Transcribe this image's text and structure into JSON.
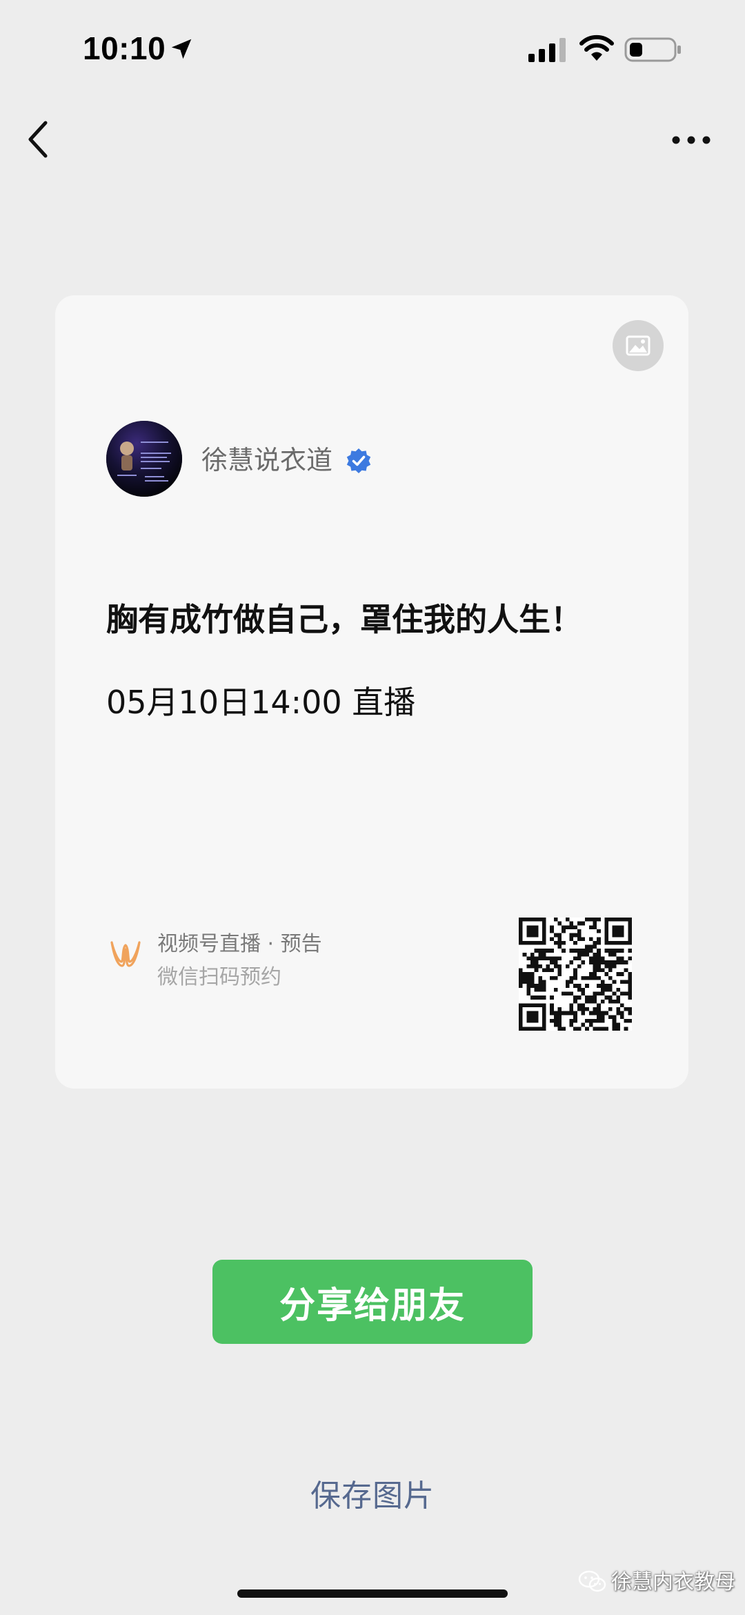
{
  "status_bar": {
    "time": "10:10",
    "location_icon": "location-arrow-icon",
    "signal_icon": "cellular-signal-icon",
    "wifi_icon": "wifi-icon",
    "battery_icon": "battery-icon",
    "battery_level": 0.3
  },
  "nav": {
    "back_icon": "chevron-left-icon",
    "more_icon": "ellipsis-icon"
  },
  "poster": {
    "image_toggle_icon": "image-icon",
    "author": {
      "name": "徐慧说衣道",
      "verified": true,
      "verified_icon": "verified-badge-icon",
      "verified_color": "#3d7ae0"
    },
    "live_title": "胸有成竹做自己，罩住我的人生！",
    "live_time": "05月10日14:00 直播",
    "footer": {
      "channels_label": "视频号直播 · 预告",
      "scan_label": "微信扫码预约",
      "channels_icon": "channels-logo-icon",
      "channels_color": "#f0a35c",
      "qr_icon": "qr-code-icon"
    }
  },
  "actions": {
    "share_label": "分享给朋友",
    "share_color": "#4cc162",
    "save_label": "保存图片",
    "save_color": "#56698f"
  },
  "watermark": {
    "icon": "wechat-icon",
    "text": "徐慧内衣教母"
  }
}
